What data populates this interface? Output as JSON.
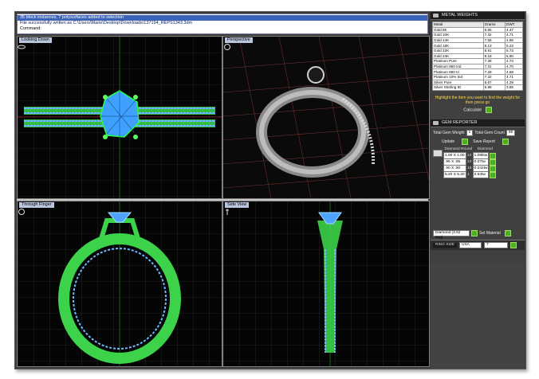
{
  "command": {
    "line1": "35 block instances, 7 polysurfaces added to selection",
    "line2": "File successfully written as C:\\Users\\Marie\\Desktop\\Downloads\\137194_REPS1343.3dm",
    "line3": "Command:"
  },
  "viewports": {
    "top_left": "Looking Down",
    "top_right": "Perspective",
    "bottom_left": "Through Finger",
    "bottom_right": "Side View"
  },
  "metal_weights": {
    "title": "METAL WEIGHTS",
    "headers": [
      "Metal",
      "Grams",
      "DWT"
    ],
    "rows": [
      [
        "Gold 8K",
        "6.95",
        "4.47"
      ],
      [
        "Gold 10K",
        "7.32",
        "4.71"
      ],
      [
        "Gold 14K",
        "7.56",
        "4.86"
      ],
      [
        "Gold 18K",
        "8.13",
        "5.23"
      ],
      [
        "Gold 22K",
        "8.91",
        "5.73"
      ],
      [
        "Gold 24K",
        "9.18",
        "5.90"
      ],
      [
        "Platinum Pure",
        "7.38",
        "4.74"
      ],
      [
        "Platinum 950 Ind",
        "7.31",
        "4.70"
      ],
      [
        "Platinum 950 Iri",
        "7.28",
        "4.68"
      ],
      [
        "Platinum 10% Ind",
        "7.32",
        "4.71"
      ],
      [
        "Silver Pure",
        "6.67",
        "4.29"
      ],
      [
        "Silver Sterling ID",
        "5.98",
        "3.85"
      ]
    ],
    "hint": "Highlight the item you want to find the weight for then press go",
    "calculate_label": "Calculate"
  },
  "gem_reporter": {
    "title": "GEM REPORTER",
    "total_weight_label": "Total Gem Weight",
    "total_weight_value": "1",
    "total_count_label": "Total Gem Count",
    "total_count_value": "65",
    "update_label": "Update",
    "save_report_label": "Save Report",
    "col_shape": "Diamond Round",
    "col_type": "Diamond",
    "rows": [
      [
        "1.00 X 1.00",
        "24",
        "1.09ktw"
      ],
      [
        ".95 X .95",
        "24",
        "0.07tw"
      ],
      [
        ".90 X .90",
        "16",
        "0.042tw"
      ],
      [
        "5.20 X 5.20",
        "1",
        "0.53tw"
      ]
    ],
    "material_value": "Diamond (3.52 spg)",
    "set_material_label": "Set Material"
  },
  "ring_size": {
    "label": "RING SIZE",
    "standard": "USA",
    "size": "7"
  }
}
